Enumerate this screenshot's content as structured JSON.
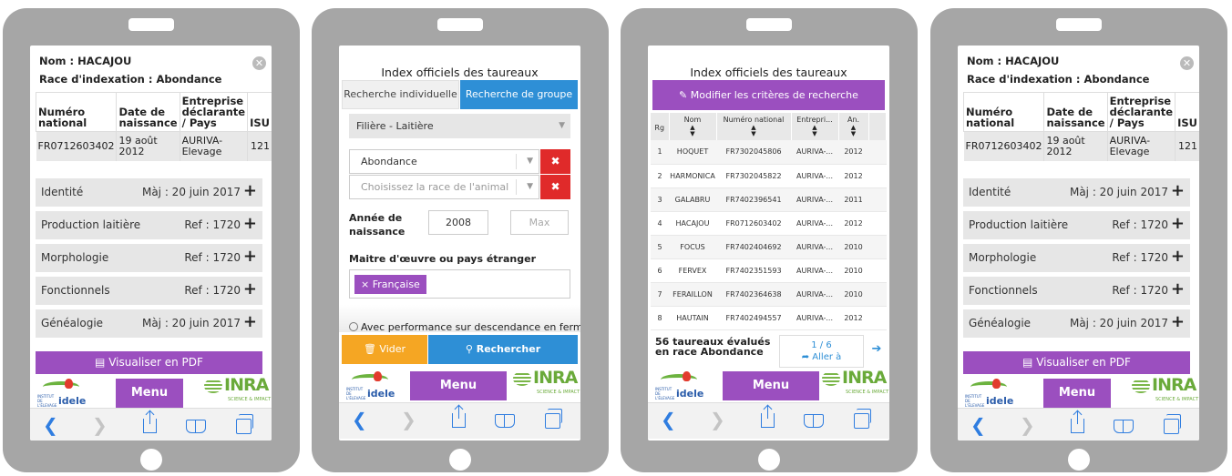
{
  "detail": {
    "name": "Nom : HACAJOU",
    "race": "Race d'indexation : Abondance",
    "columns": [
      "Numéro national",
      "Date de naissance",
      "Entreprise déclarante / Pays",
      "ISU"
    ],
    "row": [
      "FR0712603402",
      "19 août 2012",
      "AURIVA-Elevage",
      "121"
    ],
    "sections": [
      {
        "label": "Identité",
        "ref": "Màj : 20 juin 2017"
      },
      {
        "label": "Production laitière",
        "ref": "Ref : 1720"
      },
      {
        "label": "Morphologie",
        "ref": "Ref : 1720"
      },
      {
        "label": "Fonctionnels",
        "ref": "Ref : 1720"
      },
      {
        "label": "Généalogie",
        "ref": "Màj : 20 juin 2017"
      }
    ],
    "pdf_button": "Visualiser en PDF"
  },
  "footer": {
    "menu": "Menu",
    "idele_small": "INSTITUT DE L'ÉLEVAGE",
    "idele_word": "idele",
    "inra_word": "INRA",
    "inra_sub": "SCIENCE & IMPACT"
  },
  "search": {
    "title": "Index officiels des taureaux",
    "tab_individual": "Recherche individuelle",
    "tab_group": "Recherche de groupe",
    "filiere": "Filière - Laitière",
    "race_selected": "Abondance",
    "race_placeholder": "Choisissez la race de l'animal",
    "annee_label": "Année de naissance",
    "annee_min": "2008",
    "annee_max_placeholder": "Max",
    "maitre_label": "Maitre d'œuvre ou pays étranger",
    "maitre_tag": "Française",
    "perf_label": "Avec performance sur descendance en ferme",
    "vider": "Vider",
    "rechercher": "Rechercher"
  },
  "results": {
    "title": "Index officiels des taureaux",
    "modify": "Modifier les critères de recherche",
    "columns": [
      "Rg",
      "Nom",
      "Numéro national",
      "Entrepri...",
      "An."
    ],
    "rows": [
      [
        "1",
        "HOQUET",
        "FR7302045806",
        "AURIVA-...",
        "2012"
      ],
      [
        "2",
        "HARMONICA",
        "FR7302045822",
        "AURIVA-...",
        "2012"
      ],
      [
        "3",
        "GALABRU",
        "FR7402396541",
        "AURIVA-...",
        "2011"
      ],
      [
        "4",
        "HACAJOU",
        "FR0712603402",
        "AURIVA-...",
        "2012"
      ],
      [
        "5",
        "FOCUS",
        "FR7402404692",
        "AURIVA-...",
        "2010"
      ],
      [
        "6",
        "FERVEX",
        "FR7402351593",
        "AURIVA-...",
        "2010"
      ],
      [
        "7",
        "FERAILLON",
        "FR7402364638",
        "AURIVA-...",
        "2010"
      ],
      [
        "8",
        "HAUTAIN",
        "FR7402494557",
        "AURIVA-...",
        "2012"
      ]
    ],
    "count": "56 taureaux évalués en race Abondance",
    "page": "1 / 6",
    "goto": "Aller à"
  },
  "icons": {
    "back": "chevron-left-icon",
    "forward": "chevron-right-icon",
    "share": "share-icon",
    "bookmarks": "book-icon",
    "tabs": "tabs-icon"
  },
  "colors": {
    "purple": "#9b4fbf",
    "blue": "#2e8fd6",
    "orange": "#f5a623",
    "red": "#e02a2a",
    "device": "#a6a6a6"
  }
}
